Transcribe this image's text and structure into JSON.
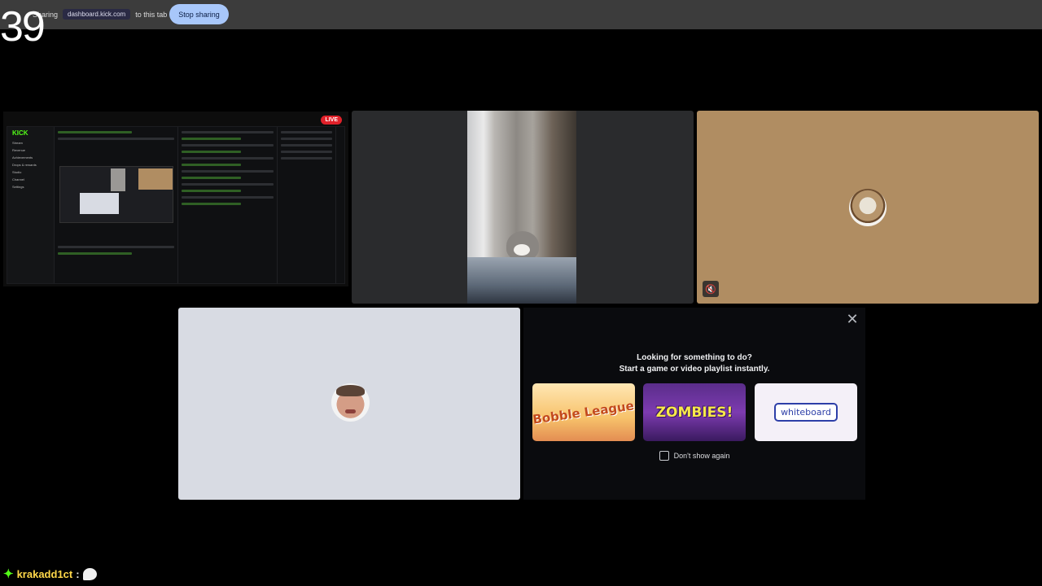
{
  "share_bar": {
    "counter": "39",
    "sharing_prefix": "Sharing",
    "domain": "dashboard.kick.com",
    "suffix": "to this tab",
    "stop_label": "Stop sharing"
  },
  "screen_share_tile": {
    "live_badge": "LIVE",
    "brand": "KICK",
    "nav_items": [
      "Stream",
      "Revenue",
      "Achievements",
      "Drops & rewards",
      "Studio",
      "Channel",
      "Settings"
    ],
    "counter_value": "39"
  },
  "promo": {
    "close_icon": "close-icon",
    "line1": "Looking for something to do?",
    "line2": "Start a game or video playlist instantly.",
    "games": [
      {
        "name": "Bobble League",
        "icon": "bobble-league-thumb"
      },
      {
        "name": "ZOMBIES!",
        "icon": "tiny-royale-zombies-thumb"
      },
      {
        "name": "whiteboard",
        "icon": "jamspace-whiteboard-thumb"
      }
    ],
    "dont_show_label": "Don't show again"
  },
  "chat": {
    "username": "krakadd1ct",
    "separator": ":",
    "emote_icon": "speech-bubble-emote"
  },
  "colors": {
    "kick_green": "#53fc18",
    "stop_button": "#a8c7fa",
    "meerkat_tile": "#b08d62",
    "grey_tile": "#d8dbe3",
    "username": "#ffd84a"
  }
}
